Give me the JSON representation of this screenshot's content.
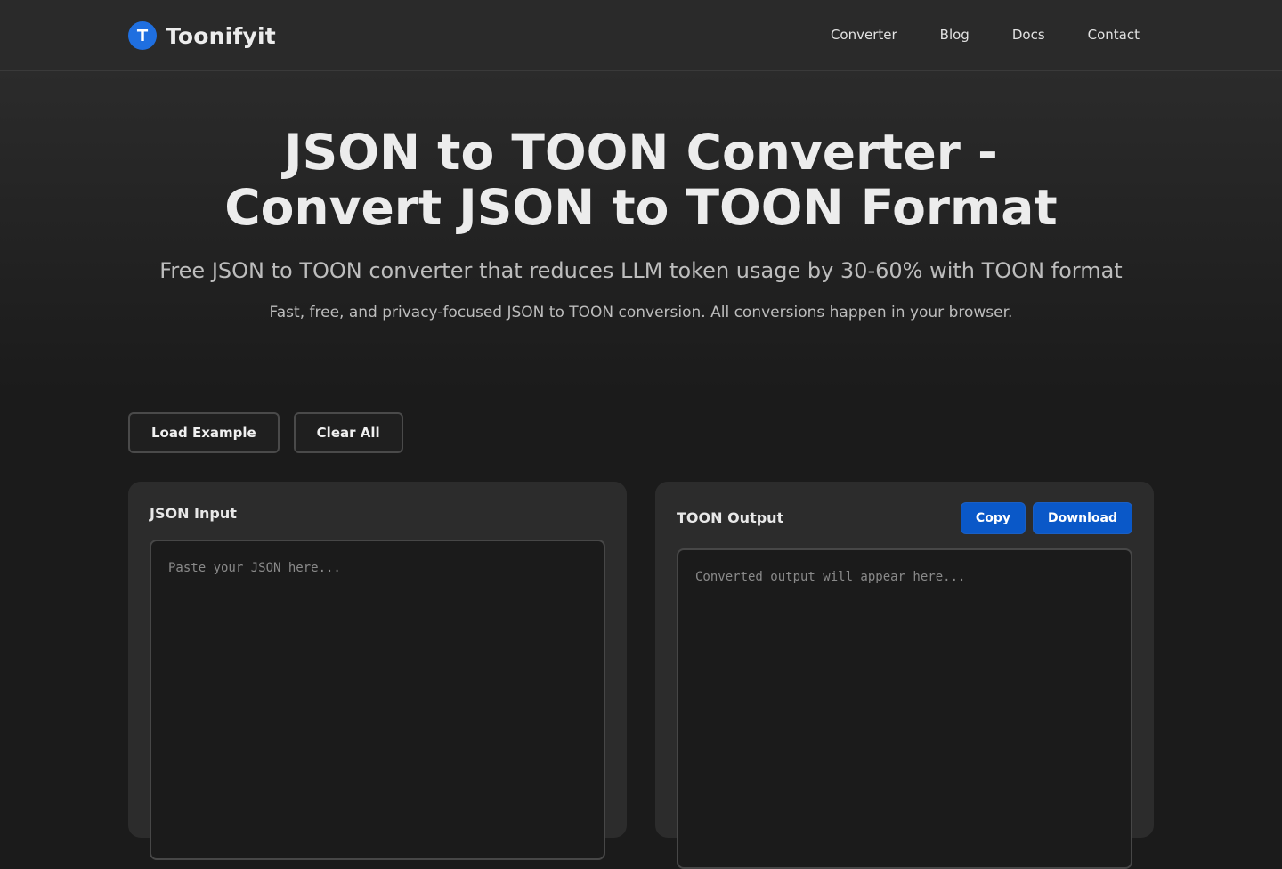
{
  "brand": {
    "logo_letter": "T",
    "name": "Toonifyit",
    "accent_color": "#1f6fe0"
  },
  "nav": {
    "items": [
      "Converter",
      "Blog",
      "Docs",
      "Contact"
    ]
  },
  "hero": {
    "title_line1": "JSON to TOON Converter -",
    "title_line2": "Convert JSON to TOON Format",
    "subtitle": "Free JSON to TOON converter that reduces LLM token usage by 30-60% with TOON format",
    "note": "Fast, free, and privacy-focused JSON to TOON conversion. All conversions happen in your browser."
  },
  "toolbar": {
    "load_example_label": "Load Example",
    "clear_all_label": "Clear All"
  },
  "input_panel": {
    "title": "JSON Input",
    "placeholder": "Paste your JSON here...",
    "value": ""
  },
  "output_panel": {
    "title": "TOON Output",
    "copy_label": "Copy",
    "download_label": "Download",
    "placeholder": "Converted output will appear here...",
    "value": ""
  },
  "colors": {
    "primary_button": "#0a58c8",
    "background": "#1b1b1b",
    "panel": "#2c2c2c"
  }
}
